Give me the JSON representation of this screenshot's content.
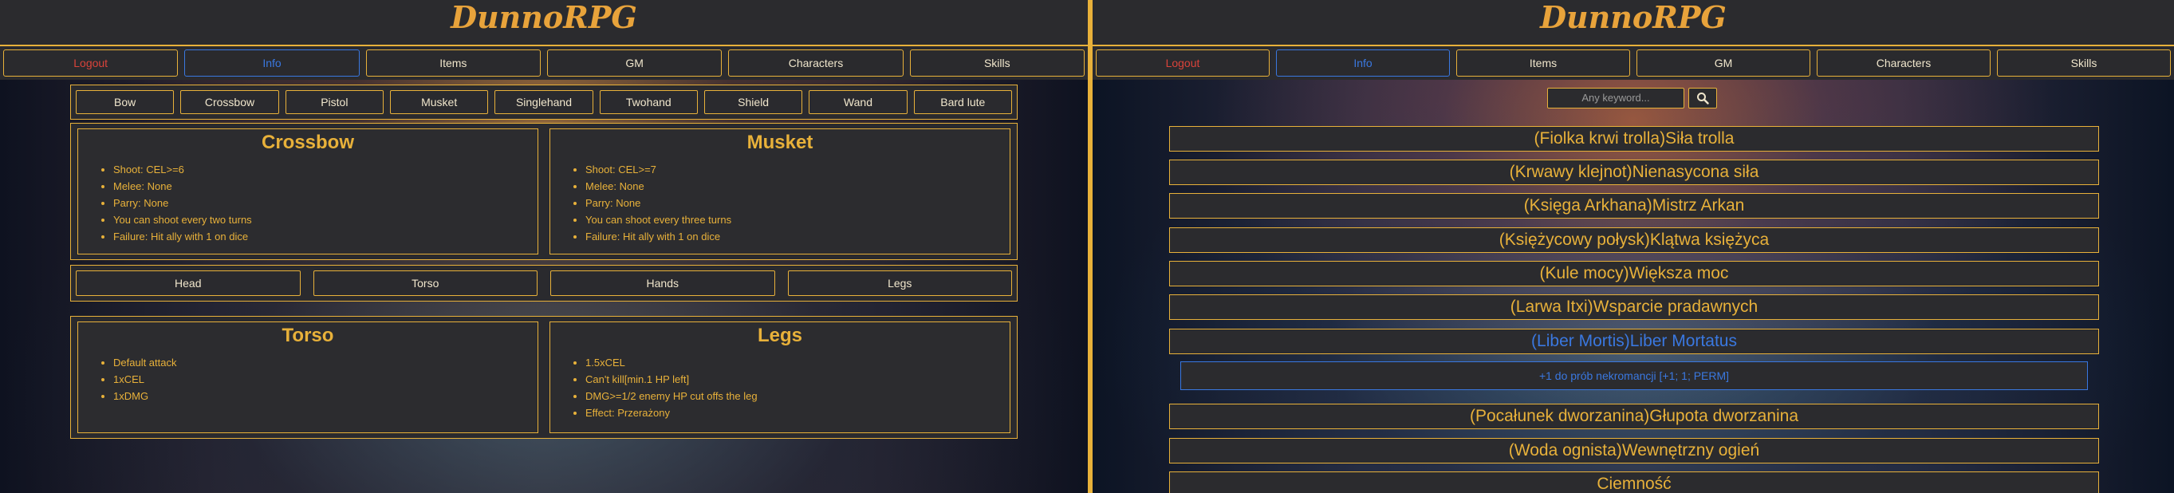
{
  "left": {
    "title": "DunnoRPG",
    "nav": [
      "Logout",
      "Info",
      "Items",
      "GM",
      "Characters",
      "Skills"
    ],
    "weapon_tabs": [
      "Bow",
      "Crossbow",
      "Pistol",
      "Musket",
      "Singlehand",
      "Twohand",
      "Shield",
      "Wand",
      "Bard lute"
    ],
    "weapon_cards": [
      {
        "title": "Crossbow",
        "items": [
          "Shoot: CEL>=6",
          "Melee: None",
          "Parry: None",
          "You can shoot every two turns",
          "Failure: Hit ally with 1 on dice"
        ]
      },
      {
        "title": "Musket",
        "items": [
          "Shoot: CEL>=7",
          "Melee: None",
          "Parry: None",
          "You can shoot every three turns",
          "Failure: Hit ally with 1 on dice"
        ]
      }
    ],
    "body_tabs": [
      "Head",
      "Torso",
      "Hands",
      "Legs"
    ],
    "body_cards": [
      {
        "title": "Torso",
        "items": [
          "Default attack",
          "1xCEL",
          "1xDMG"
        ]
      },
      {
        "title": "Legs",
        "items": [
          "1.5xCEL",
          "Can't kill[min.1 HP left]",
          "DMG>=1/2 enemy HP cut offs the leg",
          "Effect: Przerażony"
        ]
      }
    ]
  },
  "right": {
    "title": "DunnoRPG",
    "nav": [
      "Logout",
      "Info",
      "Items",
      "GM",
      "Characters",
      "Skills"
    ],
    "search": {
      "placeholder": "Any keyword..."
    },
    "items": [
      "(Fiolka krwi trolla)Siła trolla",
      "(Krwawy klejnot)Nienasycona siła",
      "(Księga Arkhana)Mistrz Arkan",
      "(Księżycowy połysk)Klątwa księżyca",
      "(Kule mocy)Większa moc",
      "(Larwa Itxi)Wsparcie pradawnych",
      "(Liber Mortis)Liber Mortatus",
      "(Pocałunek dworzanina)Głupota dworzanina",
      "(Woda ognista)Wewnętrzny ogień",
      "Ciemność"
    ],
    "active_detail": "+1 do prób nekromancji [+1; 1; PERM]"
  },
  "colors": {
    "accent": "#e8b13a",
    "active": "#3a78e0",
    "danger": "#d9433a",
    "panel": "#2b2b2e"
  }
}
